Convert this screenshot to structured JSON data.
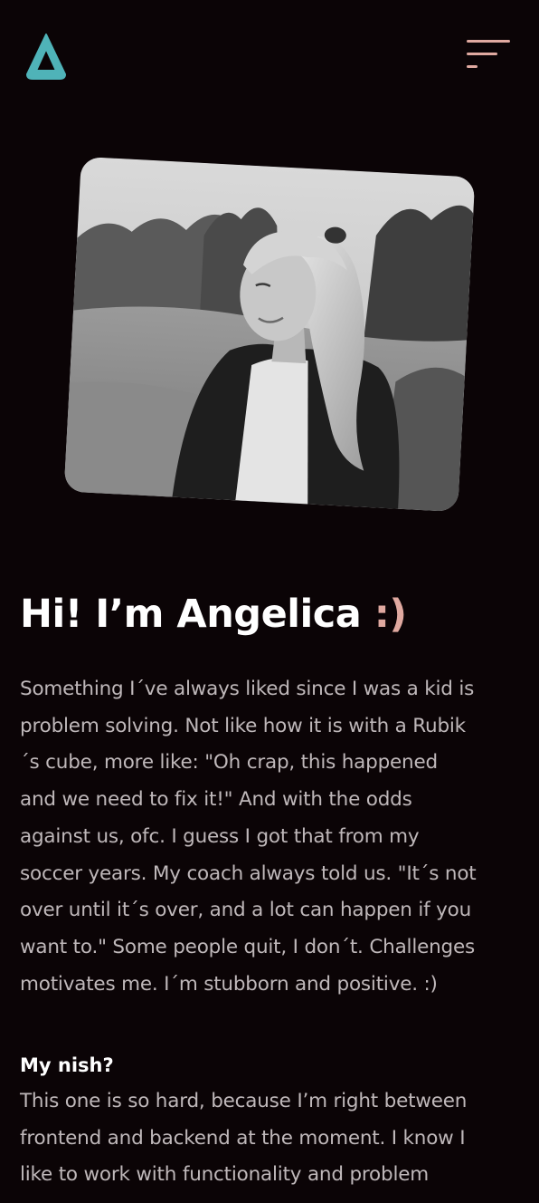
{
  "header": {
    "logo_icon": "triangle-logo-icon",
    "logo_color": "#4fb3b8",
    "menu_icon": "hamburger-menu-icon",
    "menu_color": "#e0a9a0"
  },
  "hero": {
    "photo_icon": "portrait-photo"
  },
  "about": {
    "title_text": "Hi! I’m Angelica ",
    "title_smile": ":)",
    "accent_color": "#e0a9a0",
    "intro_lines": [
      "Something I´ve always liked since I was a kid is",
      "problem solving. Not like how it is with a Rubik",
      "´s cube, more like: \"Oh crap, this happened",
      "and we need to fix it!\" And with the odds",
      "against us, ofc. I guess I got that from my",
      "soccer years. My coach always told us. \"It´s not",
      "over until it´s over, and a lot can happen if you",
      "want to.\" Some people quit, I don´t. Challenges",
      "motivates me. I´m stubborn and positive. :)"
    ],
    "nish_heading": "My nish?",
    "nish_lines": [
      "This one is so hard, because I’m right between",
      "frontend and backend at the moment. I know I",
      "like to work with functionality and problem"
    ]
  }
}
